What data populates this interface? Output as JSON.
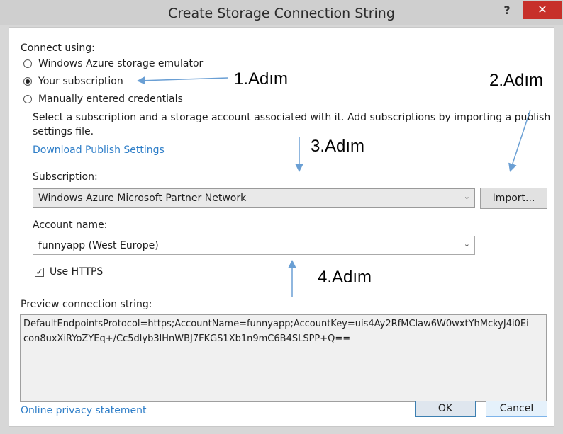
{
  "window": {
    "title": "Create Storage Connection String",
    "help": "?",
    "close": "✕"
  },
  "connect": {
    "label": "Connect using:",
    "options": [
      {
        "label": "Windows Azure storage emulator",
        "checked": false
      },
      {
        "label": "Your subscription",
        "checked": true
      },
      {
        "label": "Manually entered credentials",
        "checked": false
      }
    ]
  },
  "description": {
    "line1": "Select a subscription and a storage account associated with it. Add subscriptions by importing a publish",
    "line2": "settings file."
  },
  "download_link": "Download Publish Settings",
  "subscription": {
    "label": "Subscription:",
    "value": "Windows Azure Microsoft Partner Network",
    "import_button": "Import..."
  },
  "account": {
    "label": "Account name:",
    "value": "funnyapp (West Europe)"
  },
  "https": {
    "label": "Use HTTPS",
    "checked": true,
    "mark": "✓"
  },
  "preview": {
    "label": "Preview connection string:",
    "line1": "DefaultEndpointsProtocol=https;AccountName=funnyapp;AccountKey=uis4Ay2RfMClaw6W0wxtYhMckyJ4i0Ei",
    "line2": "con8uxXiRYoZYEq+/Cc5dlyb3lHnWBJ7FKGS1Xb1n9mC6B4SLSPP+Q=="
  },
  "footer": {
    "privacy_link": "Online privacy statement",
    "ok": "OK",
    "cancel": "Cancel"
  },
  "annotations": {
    "step1": "1.Adım",
    "step2": "2.Adım",
    "step3": "3.Adım",
    "step4": "4.Adım"
  },
  "colors": {
    "accent_link": "#2e7ec8",
    "annotation_arrow": "#6a9fd4",
    "close_button": "#c7302a"
  },
  "icons": {
    "combo_chevron": "chevron-down-icon",
    "checkbox_mark": "check-icon",
    "annotation_arrow": "arrow-icon"
  }
}
